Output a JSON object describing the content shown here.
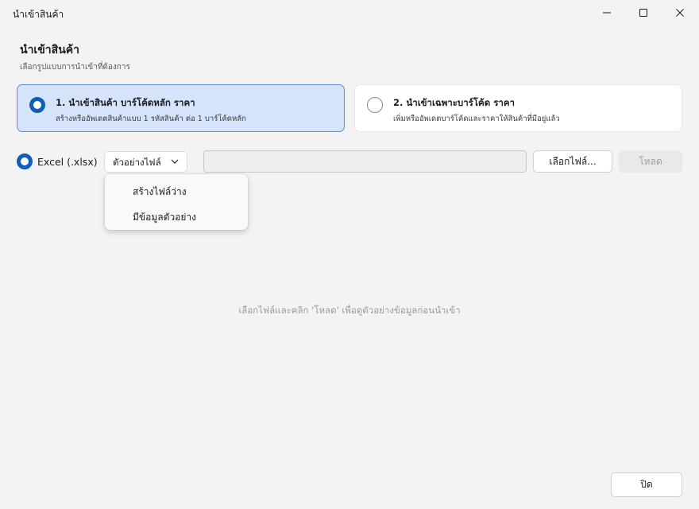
{
  "window": {
    "title": "นำเข้าสินค้า",
    "controls": {
      "minimize": "minimize-icon",
      "maximize": "maximize-icon",
      "close": "close-icon"
    }
  },
  "header": {
    "title": "นำเข้าสินค้า",
    "subtitle": "เลือกรูปแบบการนำเข้าที่ต้องการ"
  },
  "options": [
    {
      "title": "1. นำเข้าสินค้า บาร์โค้ดหลัก ราคา",
      "description": "สร้างหรืออัพเดตสินค้าแบบ 1 รหัสสินค้า ต่อ 1 บาร์โค้ดหลัก",
      "selected": true
    },
    {
      "title": "2. นำเข้าเฉพาะบาร์โค้ด ราคา",
      "description": "เพิ่มหรืออัพเดตบาร์โค้ดและราคาให้สินค้าที่มีอยู่แล้ว",
      "selected": false
    }
  ],
  "file_row": {
    "format_label": "Excel (.xlsx)",
    "format_selected": true,
    "sample_dropdown": "ตัวอย่างไฟล์",
    "file_path": "",
    "browse_label": "เลือกไฟล์...",
    "load_label": "โหลด",
    "load_enabled": false
  },
  "dropdown_menu": {
    "open": true,
    "items": [
      "สร้างไฟล์ว่าง",
      "มีข้อมูลตัวอย่าง"
    ]
  },
  "hint": "เลือกไฟล์และคลิก 'โหลด' เพื่อดูตัวอย่างข้อมูลก่อนนำเข้า",
  "footer": {
    "close_label": "ปิด"
  },
  "colors": {
    "background": "#f3f3f3",
    "accent": "#0f5fb8",
    "selected_card": "#d5e4fb",
    "selected_border": "#5b8fd9"
  }
}
